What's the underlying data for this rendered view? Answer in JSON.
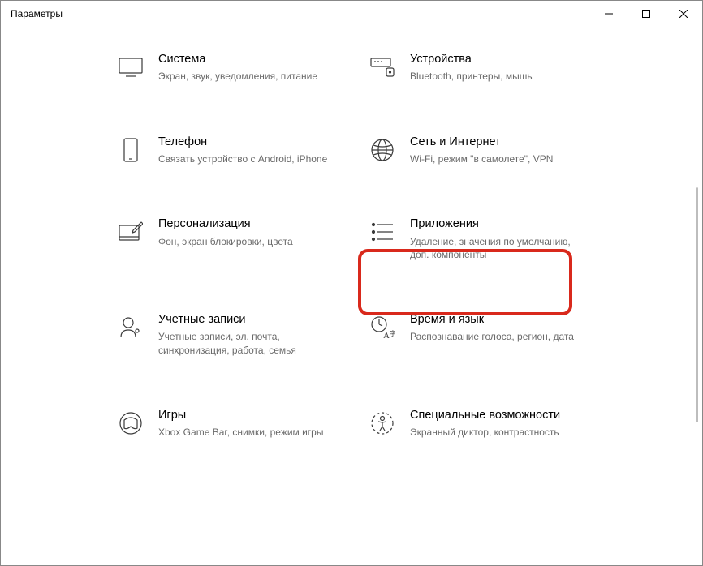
{
  "window": {
    "title": "Параметры"
  },
  "tiles": {
    "system": {
      "title": "Система",
      "desc": "Экран, звук, уведомления, питание"
    },
    "devices": {
      "title": "Устройства",
      "desc": "Bluetooth, принтеры, мышь"
    },
    "phone": {
      "title": "Телефон",
      "desc": "Связать устройство с Android, iPhone"
    },
    "network": {
      "title": "Сеть и Интернет",
      "desc": "Wi-Fi, режим \"в самолете\", VPN"
    },
    "personalize": {
      "title": "Персонализация",
      "desc": "Фон, экран блокировки, цвета"
    },
    "apps": {
      "title": "Приложения",
      "desc": "Удаление, значения по умолчанию, доп. компоненты"
    },
    "accounts": {
      "title": "Учетные записи",
      "desc": "Учетные записи, эл. почта, синхронизация, работа, семья"
    },
    "time": {
      "title": "Время и язык",
      "desc": "Распознавание голоса, регион, дата"
    },
    "gaming": {
      "title": "Игры",
      "desc": "Xbox Game Bar, снимки, режим игры"
    },
    "accessibility": {
      "title": "Специальные возможности",
      "desc": "Экранный диктор, контрастность"
    }
  },
  "highlight": "apps"
}
